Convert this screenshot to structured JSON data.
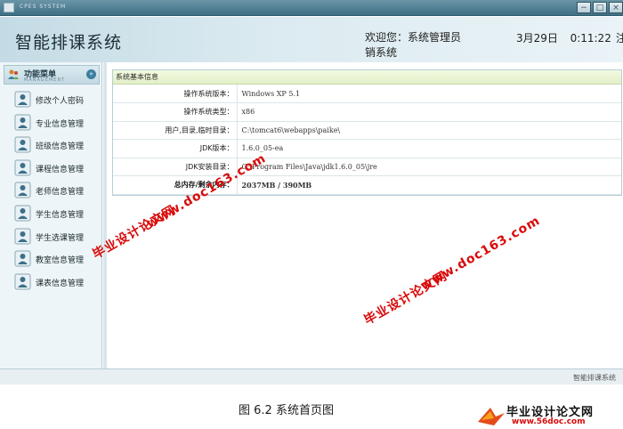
{
  "window": {
    "system_label": "CPES SYSTEM",
    "buttons": [
      "−",
      "□",
      "×"
    ]
  },
  "header": {
    "app_title": "智能排课系统",
    "welcome": "欢迎您：系统管理员",
    "logout": "销系统",
    "date": "3月29日",
    "time": "0:11:22",
    "overflow_char": "注"
  },
  "sidebar": {
    "menu_title": "功能菜单",
    "menu_subtitle": "MANAGEMENT",
    "collapse_glyph": "»",
    "items": [
      {
        "label": "修改个人密码",
        "icon": "user-card-icon"
      },
      {
        "label": "专业信息管理",
        "icon": "user-card-icon"
      },
      {
        "label": "班级信息管理",
        "icon": "user-card-icon"
      },
      {
        "label": "课程信息管理",
        "icon": "user-card-icon"
      },
      {
        "label": "老师信息管理",
        "icon": "user-card-icon"
      },
      {
        "label": "学生信息管理",
        "icon": "user-card-icon"
      },
      {
        "label": "学生选课管理",
        "icon": "user-card-icon"
      },
      {
        "label": "教室信息管理",
        "icon": "user-card-icon"
      },
      {
        "label": "课表信息管理",
        "icon": "user-card-icon"
      }
    ]
  },
  "panel": {
    "title": "系统基本信息",
    "rows": [
      {
        "key": "操作系统版本：",
        "value": "Windows XP  5.1"
      },
      {
        "key": "操作系统类型：",
        "value": "x86"
      },
      {
        "key": "用户,目录,临时目录：",
        "value": "C:\\tomcat6\\webapps\\paike\\"
      },
      {
        "key": "JDK版本：",
        "value": "1.6.0_05-ea"
      },
      {
        "key": "JDK安装目录：",
        "value": "C:\\Program Files\\Java\\jdk1.6.0_05\\jre"
      },
      {
        "key": "总内存/剩余内存：",
        "value": "2037MB  /  390MB"
      }
    ]
  },
  "footer": {
    "text": "智能排课系统"
  },
  "caption": "图 6.2 系统首页图",
  "watermarks": {
    "cn": "毕业设计论文网",
    "url": "www.doc163.com"
  },
  "corner_logo": {
    "text": "毕业设计论文网",
    "url": "www.56doc.com"
  },
  "colors": {
    "header_bg": "#c4dbe5",
    "accent": "#3d7fa0",
    "watermark": "#d90a0a"
  }
}
